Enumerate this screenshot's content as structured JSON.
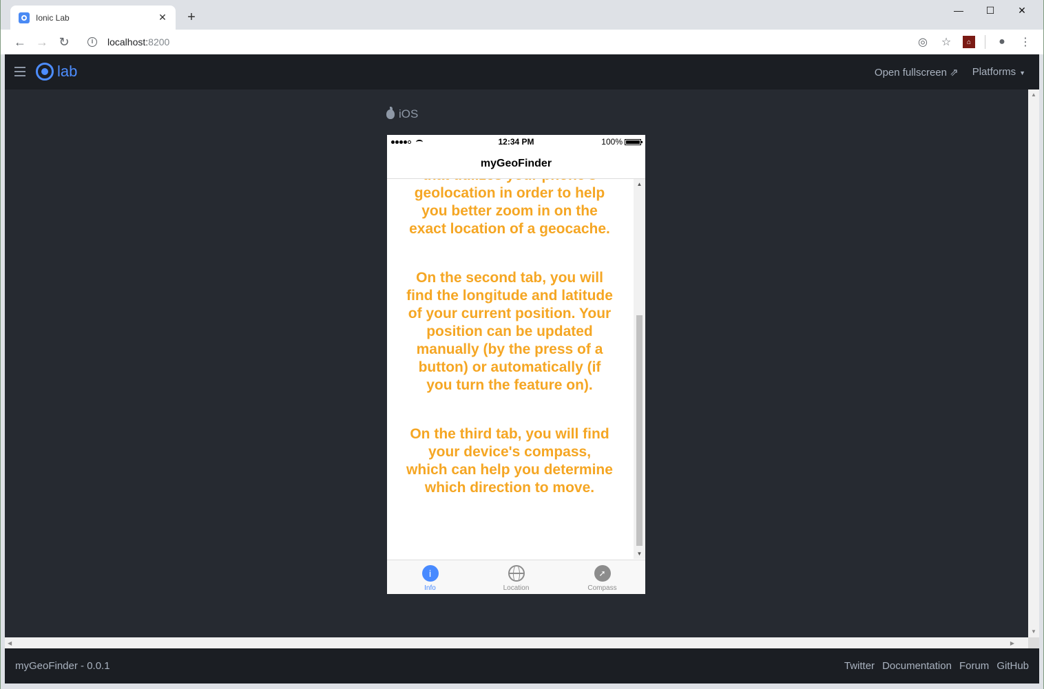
{
  "browser": {
    "tab_title": "Ionic Lab",
    "new_tab": "+",
    "url_host": "localhost:",
    "url_port": "8200"
  },
  "lab": {
    "logo_text": "lab",
    "open_fullscreen": "Open fullscreen",
    "platforms": "Platforms",
    "platform_label": "iOS",
    "footer_version": "myGeoFinder - 0.0.1",
    "footer_links": [
      "Twitter",
      "Documentation",
      "Forum",
      "GitHub"
    ]
  },
  "phone": {
    "status_time": "12:34 PM",
    "battery": "100%",
    "title": "myGeoFinder",
    "paragraphs": [
      "that utilizes your phone's geolocation in order to help you better zoom in on the exact location of a geocache.",
      "On the second tab, you will find the longitude and latitude of your current position. Your position can be updated manually (by the press of a button) or automatically (if you turn the feature on).",
      "On the third tab, you will find your device's compass, which can help you determine which direction to move."
    ],
    "tabs": [
      "Info",
      "Location",
      "Compass"
    ]
  },
  "colors": {
    "accent": "#488aff",
    "content_text": "#f5a623",
    "lab_bg": "#262a31",
    "lab_header": "#1b1e23"
  }
}
